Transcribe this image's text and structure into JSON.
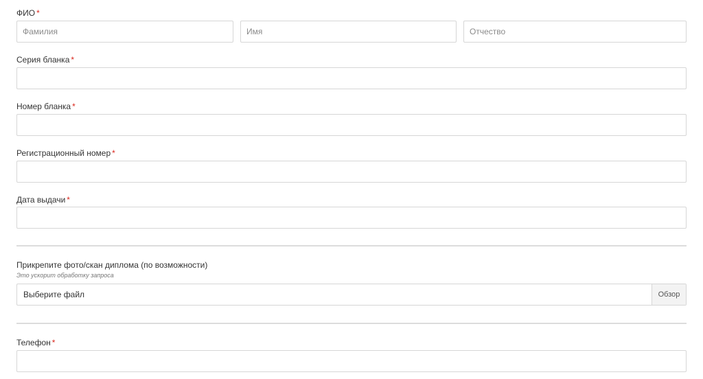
{
  "fio": {
    "label": "ФИО",
    "required_mark": "*",
    "surname_placeholder": "Фамилия",
    "name_placeholder": "Имя",
    "patronymic_placeholder": "Отчество"
  },
  "series": {
    "label": "Серия бланка",
    "required_mark": "*",
    "value": ""
  },
  "number": {
    "label": "Номер бланка",
    "required_mark": "*",
    "value": ""
  },
  "reg_number": {
    "label": "Регистрационный номер",
    "required_mark": "*",
    "value": ""
  },
  "issue_date": {
    "label": "Дата выдачи",
    "required_mark": "*",
    "value": ""
  },
  "attachment": {
    "label": "Прикрепите фото/скан диплома (по возможности)",
    "hint": "Это ускорит обработку запроса",
    "file_text": "Выберите файл",
    "browse_label": "Обзор"
  },
  "phone": {
    "label": "Телефон",
    "required_mark": "*",
    "value": ""
  },
  "colors": {
    "required": "#d9261c",
    "border": "#d6d6d6",
    "divider": "#dcdcdc"
  }
}
